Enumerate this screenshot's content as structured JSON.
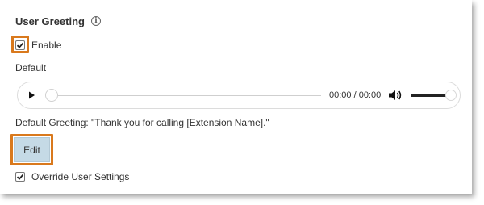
{
  "section": {
    "title": "User Greeting",
    "info_icon": "info-icon"
  },
  "enable": {
    "label": "Enable",
    "checked": true
  },
  "default_label": "Default",
  "player": {
    "time": "00:00 / 00:00",
    "progress": 0,
    "volume": 1.0,
    "icons": [
      "play-icon",
      "volume-icon"
    ]
  },
  "greeting_text": "Default Greeting: \"Thank you for calling [Extension Name].\"",
  "edit": {
    "label": "Edit"
  },
  "override": {
    "label": "Override User Settings",
    "checked": true
  },
  "colors": {
    "highlight": "#d9791d",
    "edit_button": "#c5dae6"
  }
}
